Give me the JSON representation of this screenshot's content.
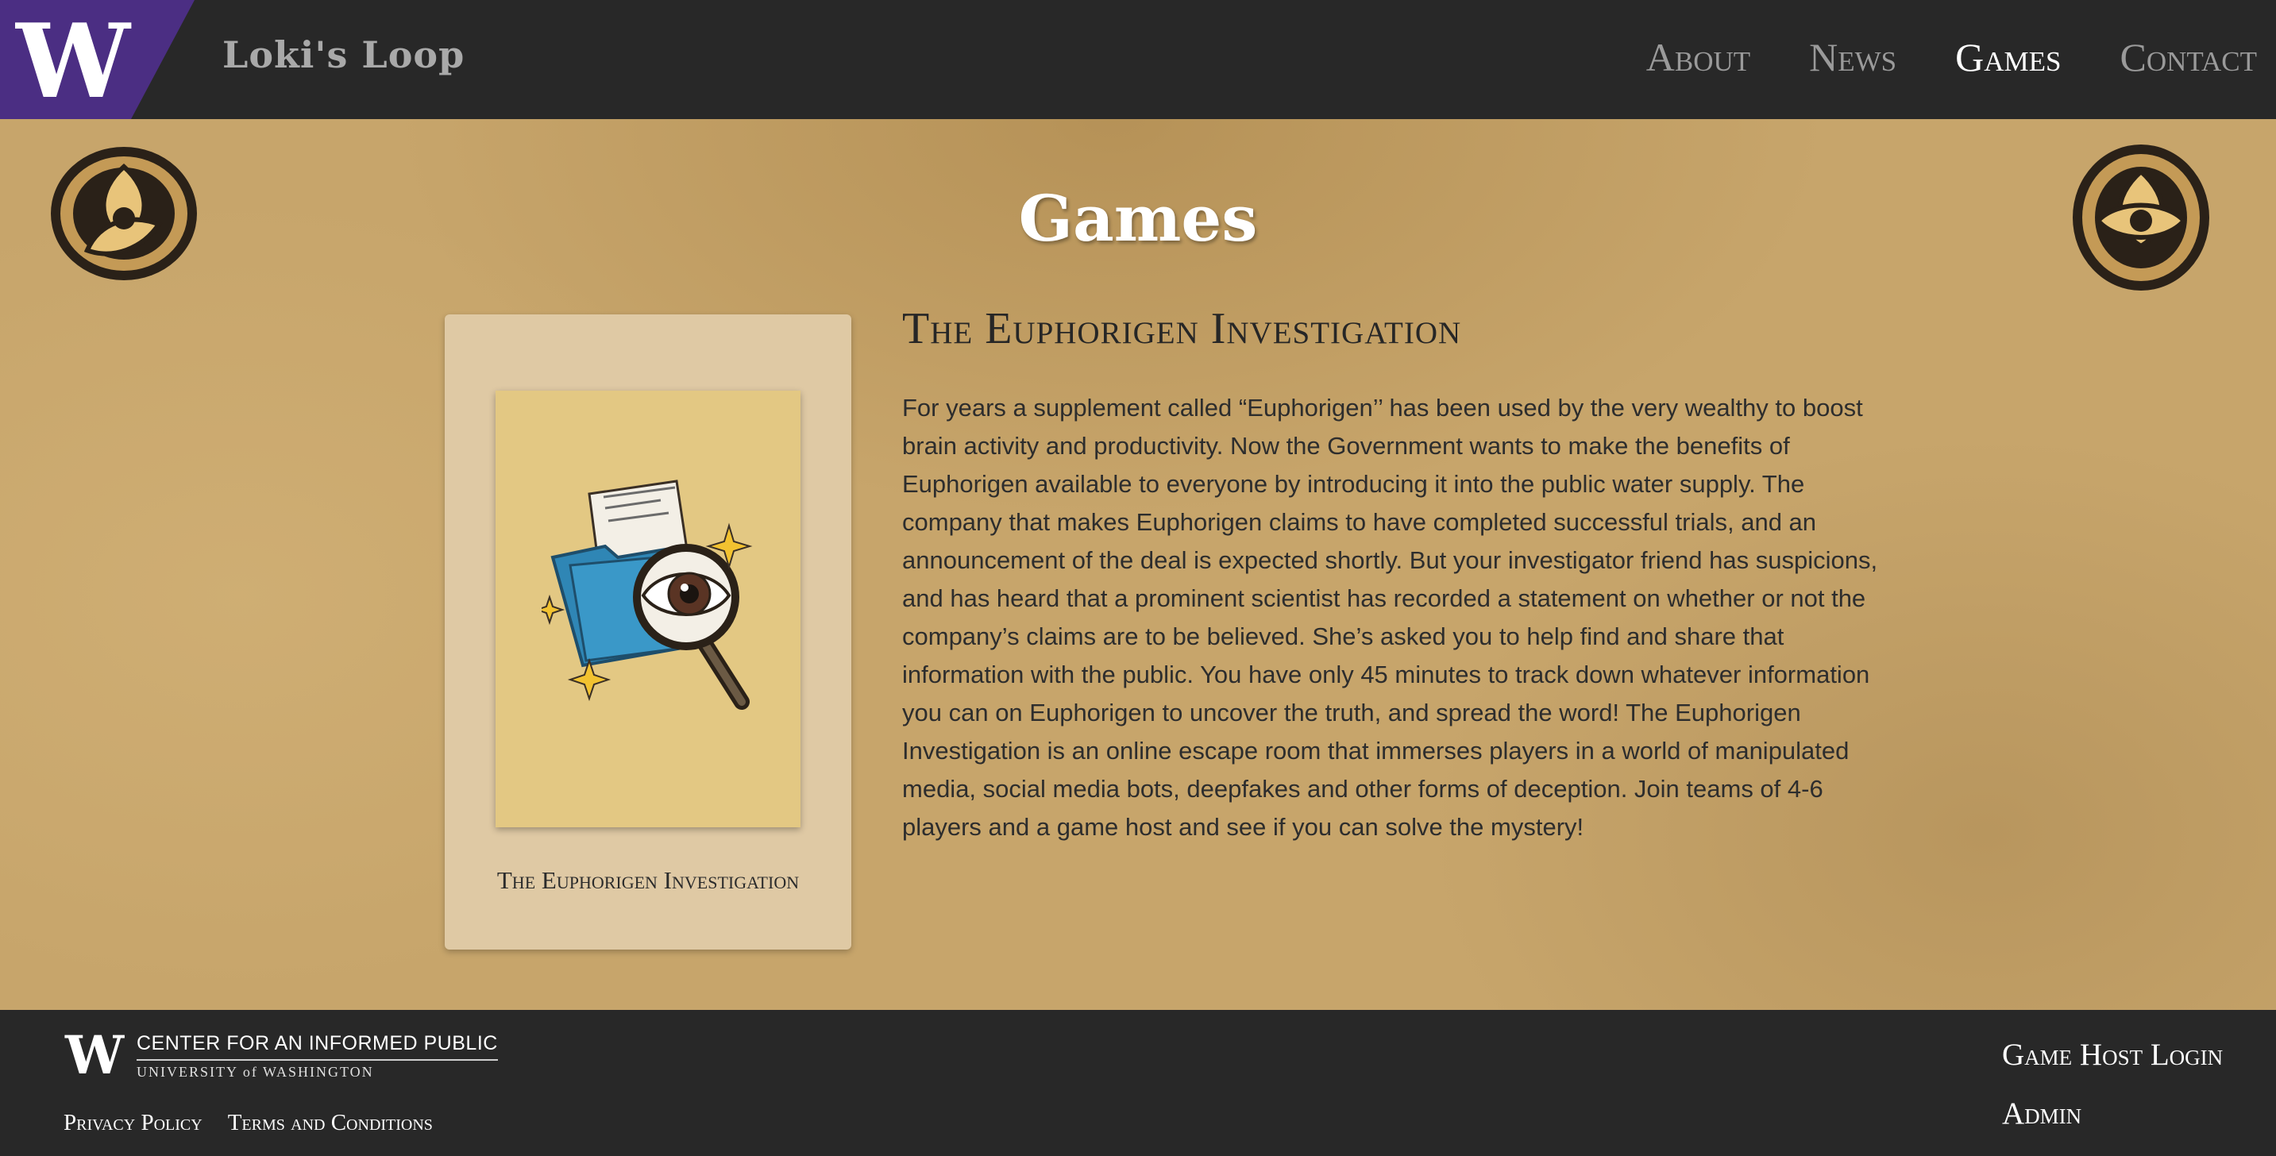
{
  "header": {
    "logo_letter": "W",
    "site_title": "Loki's Loop",
    "nav": [
      {
        "label": "About",
        "active": false
      },
      {
        "label": "News",
        "active": false
      },
      {
        "label": "Games",
        "active": true
      },
      {
        "label": "Contact",
        "active": false
      }
    ]
  },
  "colors": {
    "uw_purple": "#4b2e83",
    "header_bg": "#282828",
    "parchment": "#c7a56b",
    "card_bg": "#dfc9a4",
    "card_art_bg": "#e3c883",
    "folder_blue": "#2f86b5",
    "sparkle_yellow": "#f2c230"
  },
  "icons": {
    "header_logo": "uw-w-logo-icon",
    "emblem": "triquetra-emblem-icon",
    "card_art": "folder-magnifier-eye-icon",
    "footer_logo": "uw-w-logo-icon"
  },
  "main": {
    "page_title": "Games",
    "game": {
      "card_caption": "The Euphorigen Investigation",
      "heading": "The Euphorigen Investigation",
      "description": "For years a supplement called “Euphorigen’’ has been used by the very wealthy to boost brain activity and productivity. Now the Government wants to make the benefits of Euphorigen available to everyone by introducing it into the public water supply. The company that makes Euphorigen claims to have completed successful trials, and an announcement of the deal is expected shortly. But your investigator friend has suspicions, and has heard that a prominent scientist has recorded a statement on whether or not the company’s claims are to be believed. She’s asked you to help find and share that information with the public. You have only 45 minutes to track down whatever information you can on Euphorigen to uncover the truth, and spread the word! The Euphorigen Investigation is an online escape room that immerses players in a world of manipulated media, social media bots, deepfakes and other forms of deception. Join teams of 4-6 players and a game host and see if you can solve the mystery!"
    }
  },
  "footer": {
    "org_name": "CENTER FOR AN INFORMED PUBLIC",
    "university": "UNIVERSITY of WASHINGTON",
    "links": [
      "Privacy Policy",
      "Terms and Conditions"
    ],
    "right_links": [
      "Game Host Login",
      "Admin"
    ]
  }
}
